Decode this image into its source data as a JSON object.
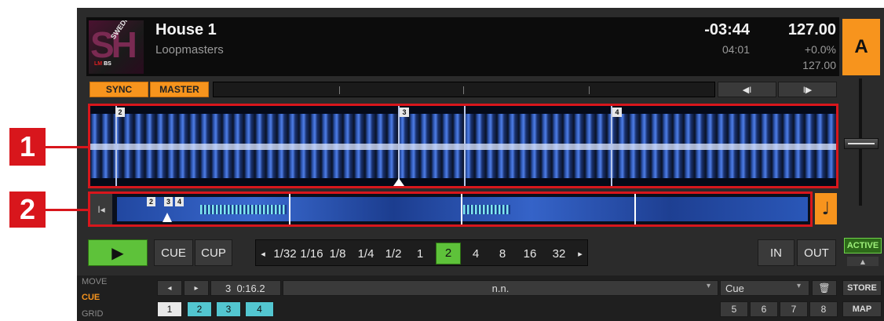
{
  "track": {
    "title": "House 1",
    "artist": "Loopmasters",
    "remaining": "-03:44",
    "length": "04:01",
    "bpm": "127.00",
    "pitch": "+0.0%",
    "original_bpm": "127.00",
    "cover_text": "SWEDISH HOUSE",
    "cover_tag_red": "LM",
    "cover_tag_white": "BS"
  },
  "deck": {
    "letter": "A"
  },
  "transport_top": {
    "sync_label": "SYNC",
    "master_label": "MASTER",
    "prev_icon_char": "◀I",
    "next_icon_char": "I▶"
  },
  "callouts": {
    "one": "1",
    "two": "2"
  },
  "waveform_markers": [
    "2",
    "3",
    "4"
  ],
  "overview_markers": [
    "2",
    "3",
    "4"
  ],
  "playback": {
    "play_icon_char": "▶",
    "cue_label": "CUE",
    "cup_label": "CUP",
    "loop_sizes": [
      "1/32",
      "1/16",
      "1/8",
      "1/4",
      "1/2",
      "1",
      "2",
      "4",
      "8",
      "16",
      "32"
    ],
    "selected_loop": "2",
    "left_arrow_char": "◂",
    "right_arrow_char": "▸",
    "in_label": "IN",
    "out_label": "OUT",
    "active_label": "ACTIVE",
    "active_arrow_char": "▲"
  },
  "bottom": {
    "modes": [
      "MOVE",
      "CUE",
      "GRID"
    ],
    "active_mode": "CUE",
    "nav_left_char": "◂",
    "nav_right_char": "▸",
    "cue_position": "3  0:16.2",
    "cue_name": "n.n.",
    "cue_type": "Cue",
    "dropdown_char": "▾",
    "trash_char": "🗑",
    "store_label": "STORE",
    "map_label": "MAP",
    "hotcues_left": [
      "1",
      "2",
      "3",
      "4"
    ],
    "hotcues_right": [
      "5",
      "6",
      "7",
      "8"
    ]
  },
  "colors": {
    "accent_orange": "#f7941d",
    "play_green": "#5ec23a",
    "cyan": "#53c6d0",
    "red_callout": "#d8161c",
    "waveform_blue": "#4f7fe8"
  }
}
